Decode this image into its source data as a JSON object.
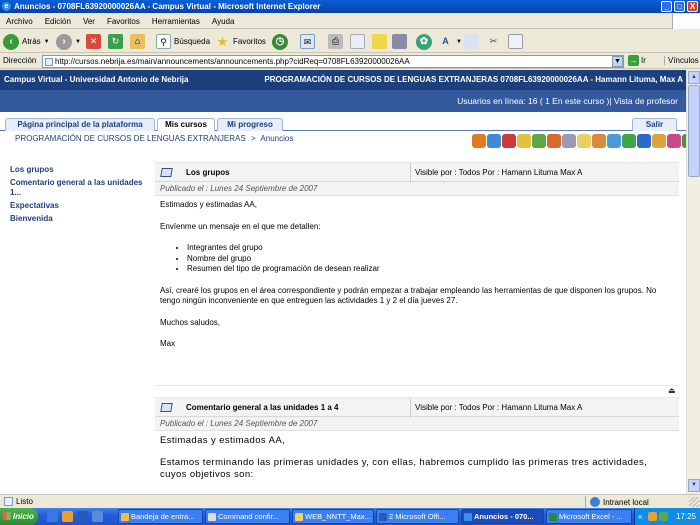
{
  "window": {
    "title": "Anuncios - 0708FL63920000026AA - Campus Virtual - Microsoft Internet Explorer",
    "controls": [
      "_",
      "□",
      "X"
    ]
  },
  "menu": [
    "Archivo",
    "Edición",
    "Ver",
    "Favoritos",
    "Herramientas",
    "Ayuda"
  ],
  "toolbar": {
    "back_label": "Atrás",
    "search_label": "Búsqueda",
    "favorites_label": "Favoritos"
  },
  "address": {
    "label": "Dirección",
    "url": "http://cursos.nebrija.es/main/announcements/announcements.php?cidReq=0708FL63920000026AA",
    "go_label": "Ir",
    "links_label": "Vínculos"
  },
  "campus": {
    "left_title": "Campus Virtual - Universidad Antonio de Nebrija",
    "course_title": "PROGRAMACIÓN DE CURSOS DE LENGUAS EXTRANJERAS 0708FL63920000026AA - Hamann Lituma, Max A",
    "online": "Usuarios en línea:  16  ( 1 En este curso )| Vista de profesor"
  },
  "tabs": [
    {
      "label": "Página principal de la plataforma"
    },
    {
      "label": "Mis cursos"
    },
    {
      "label": "Mi progreso"
    }
  ],
  "exit_label": "Salir",
  "breadcrumb": {
    "course": "PROGRAMACIÓN DE CURSOS DE LENGUAS EXTRANJERAS",
    "sep": ">",
    "section": "Anuncios"
  },
  "tool_icons": [
    {
      "name": "agenda-icon",
      "color": "#e07b20"
    },
    {
      "name": "chat-icon",
      "color": "#3c8ad8"
    },
    {
      "name": "link-icon",
      "color": "#cc3b3b"
    },
    {
      "name": "document-icon",
      "color": "#e2c23a"
    },
    {
      "name": "group-icon",
      "color": "#5aa84a"
    },
    {
      "name": "quiz-icon",
      "color": "#d86a2a"
    },
    {
      "name": "mail-icon",
      "color": "#9a9ab8"
    },
    {
      "name": "forum-icon",
      "color": "#e8d060"
    },
    {
      "name": "users-icon",
      "color": "#d88c3a"
    },
    {
      "name": "dropbox-icon",
      "color": "#4a9ad8"
    },
    {
      "name": "survey-icon",
      "color": "#3aa84a"
    },
    {
      "name": "wiki-icon",
      "color": "#2a6ac8"
    },
    {
      "name": "notebook-icon",
      "color": "#e0a23a"
    },
    {
      "name": "edit-icon",
      "color": "#c84a8a"
    },
    {
      "name": "tracking-icon",
      "color": "#5a8a3a"
    }
  ],
  "sidebar": {
    "items": [
      {
        "label": "Los grupos"
      },
      {
        "label": "Comentario general a las unidades 1..."
      },
      {
        "label": "Expectativas"
      },
      {
        "label": "Bienvenida"
      }
    ]
  },
  "posts": [
    {
      "title": "Los grupos",
      "meta": "Visible por :  Todos   Por :  Hamann Lituma Max A",
      "date": "Publicado el : Lunes 24 Septiembre de 2007",
      "greeting": "Estimados y estimadas AA,",
      "intro": "Envíenme un mensaje en el que me detallen:",
      "bullets": [
        "Integrantes del grupo",
        "Nombre del grupo",
        "Resumen del tipo de programación de desean realizar"
      ],
      "paragraph": "Así, crearé los grupos en el área correspondiente y podrán empezar a trabajar empleando las herramientas de que disponen los grupos. No tengo ningún inconveniente en que entreguen las actividades 1 y 2 el día jueves 27.",
      "closing": "Muchos saludos,",
      "signature": "Max"
    },
    {
      "title": "Comentario general a las unidades 1 a 4",
      "meta": "Visible por :  Todos   Por :  Hamann Lituma Max A",
      "date": "Publicado el : Lunes 24 Septiembre de 2007",
      "greeting": "Estimadas y estimados AA,",
      "paragraph": "Estamos terminando las primeras unidades y, con ellas, habremos cumplido las primeras tres actividades, cuyos objetivos son:"
    }
  ],
  "status": {
    "text": "Listo",
    "zone": "Intranet local"
  },
  "taskbar": {
    "start_label": "Inicio",
    "tasks": [
      {
        "label": "Bandeja de entra..."
      },
      {
        "label": "Command confir..."
      },
      {
        "label": "WEB_NNTT_Max..."
      },
      {
        "label": "2 Microsoft Offi..."
      },
      {
        "label": "Anuncios - 070..."
      },
      {
        "label": "Microsoft Excel - ..."
      }
    ],
    "clock": "17:25"
  }
}
